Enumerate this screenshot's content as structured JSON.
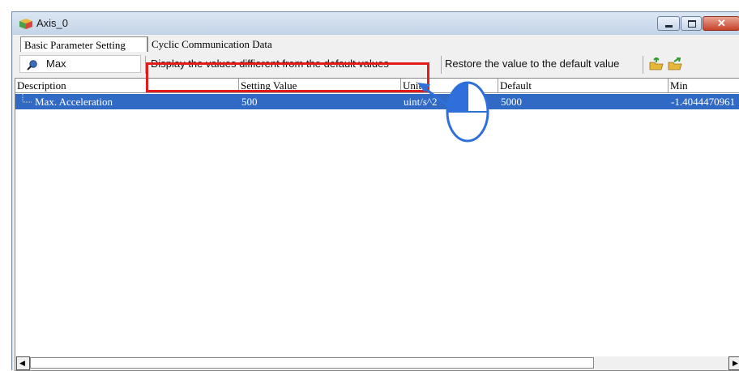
{
  "window": {
    "title": "Axis_0"
  },
  "tabs": [
    {
      "label": "Basic Parameter Setting"
    },
    {
      "label": "Cyclic Communication Data"
    }
  ],
  "toolbar": {
    "search_value": "Max",
    "show_diff_label": "Display the values diffierent from the default values",
    "restore_label": "Restore the value to the default value",
    "import_icon": "import-folder-icon",
    "export_icon": "export-folder-icon"
  },
  "table": {
    "columns": [
      "Description",
      "Setting Value",
      "Unit",
      "Default",
      "Min"
    ],
    "rows": [
      {
        "description": "Max. Acceleration",
        "setting_value": "500",
        "unit": "uint/s^2",
        "default": "5000",
        "min": "-1.4044470961"
      }
    ]
  },
  "colors": {
    "highlight_box": "#e21b1b",
    "selected_row": "#316ac5",
    "callout_arrow": "#2f6fdc"
  },
  "callout_icon": "mouse-left-click-icon"
}
